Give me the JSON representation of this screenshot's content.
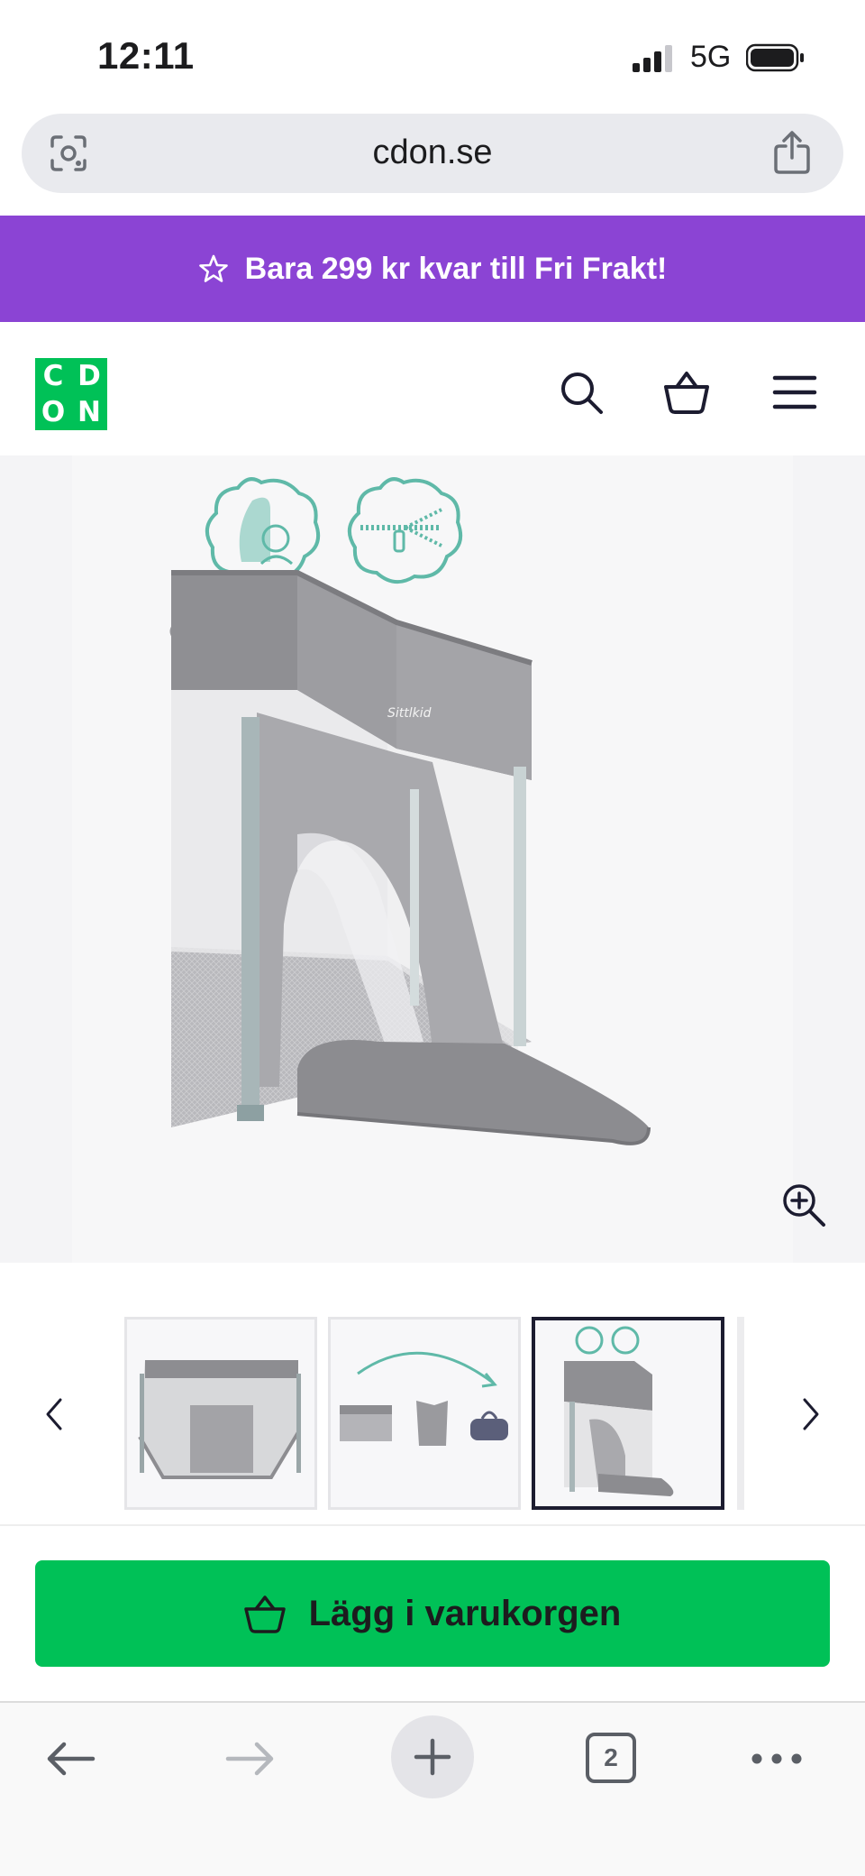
{
  "status_bar": {
    "time": "12:11",
    "network": "5G"
  },
  "browser": {
    "url": "cdon.se",
    "tab_count": "2"
  },
  "promo": {
    "text": "Bara 299 kr kvar till Fri Frakt!"
  },
  "logo": {
    "letters": [
      "C",
      "D",
      "O",
      "N"
    ]
  },
  "product": {
    "brand_on_fabric": "Sittlkid"
  },
  "gallery": {
    "selected_index": 2,
    "thumbnail_count": 3
  },
  "cta": {
    "label": "Lägg i varukorgen"
  },
  "colors": {
    "promo_purple": "#8b44d4",
    "brand_green": "#00c157",
    "text_dark": "#1c1c1e"
  },
  "icons": {
    "header": [
      "search-icon",
      "basket-icon",
      "menu-icon"
    ],
    "bottom": [
      "back-arrow-icon",
      "forward-arrow-icon",
      "new-tab-icon",
      "tabs-icon",
      "more-icon"
    ]
  }
}
